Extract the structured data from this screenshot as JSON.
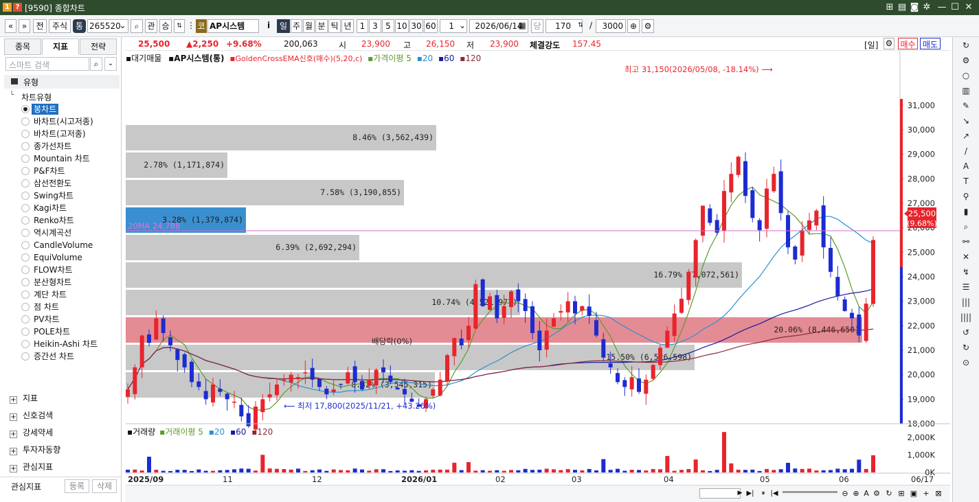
{
  "window": {
    "title": "[9590] 종합차트"
  },
  "toolbar": {
    "prev_label": "«",
    "next_label": "»",
    "all_label": "전",
    "stock_label": "주식",
    "tong_label": "통",
    "code": "265520",
    "gwan_label": "관",
    "seung_label": "승",
    "go_label": "코",
    "system_name": "AP시스템",
    "i_label": "i",
    "periods": [
      "일",
      "주",
      "월",
      "분",
      "틱",
      "년"
    ],
    "numbers": [
      "1",
      "3",
      "5",
      "10",
      "30",
      "60"
    ],
    "sel_value": "1",
    "date": "2026/06/14",
    "dang_label": "당",
    "count": "170",
    "total": "3000",
    "slash": "/"
  },
  "left_panel": {
    "tabs": [
      "종목",
      "지표",
      "전략"
    ],
    "search_placeholder": "스마트 검색",
    "root_label": "유형",
    "group_label": "차트유형",
    "chart_types": [
      "봉차트",
      "바차트(시고저종)",
      "바차트(고저종)",
      "종가선차트",
      "Mountain 차트",
      "P&F차트",
      "삼선전환도",
      "Swing차트",
      "Kagi차트",
      "Renko차트",
      "역시계곡선",
      "CandleVolume",
      "EquiVolume",
      "FLOW차트",
      "분산형차트",
      "계단 차트",
      "점 차트",
      "PV차트",
      "POLE차트",
      "Heikin-Ashi 차트",
      "증간선 차트"
    ],
    "sections": [
      "지표",
      "신호검색",
      "강세약세",
      "투자자동향",
      "관심지표"
    ],
    "footer_label": "관심지표",
    "register_label": "등록",
    "delete_label": "삭제"
  },
  "quote": {
    "price": "25,500",
    "change": "▲2,250",
    "change_pct": "+9.68%",
    "volume": "200,063",
    "open_label": "시",
    "open": "23,900",
    "high_label": "고",
    "high": "26,150",
    "low_label": "저",
    "low": "23,900",
    "strength_label": "체결강도",
    "strength": "157.45",
    "period_tag": "[일]",
    "buy_label": "매수",
    "sell_label": "매도"
  },
  "legend": {
    "items": [
      "대기매물",
      "AP시스템(통)",
      "GoldenCrossEMA신호(매수)(5,20,c)",
      "가격이평 5",
      "20",
      "60",
      "120"
    ]
  },
  "volume_legend": {
    "items": [
      "거래량",
      "거래이평 5",
      "20",
      "60",
      "120"
    ]
  },
  "colors": {
    "up": "#e8242c",
    "down": "#1c2cd0",
    "ma5": "#5a9a2a",
    "ma20": "#2a8fd0",
    "ma60": "#1a1a9a",
    "ma120": "#8a2a3a",
    "profile_gray": "#c8c8c8",
    "profile_peak": "#e48c94",
    "titlebar": "#2e4b2e"
  },
  "price_profile": [
    {
      "label": "8.42% (3,545,315)"
    },
    {
      "label": "15.50% (6,526,598)"
    },
    {
      "label": "20.06% (8,446,650)"
    },
    {
      "label": "10.74% (4,521,977)"
    },
    {
      "label": "16.79% (7,072,561)"
    },
    {
      "label": "6.39% (2,692,294)"
    },
    {
      "label": "3.28% (1,379,874)"
    },
    {
      "label": "7.58% (3,190,855)"
    },
    {
      "label": "2.78% (1,171,874)"
    },
    {
      "label": "8.46% (3,562,439)"
    }
  ],
  "annotations": {
    "high_note": "최고 31,150(2026/05/08, -18.14%)",
    "low_note": "최저 17,800(2025/11/21, +43.26%)",
    "dividend_note": "배당락(0%)",
    "ma20_label": "20MA 24,788"
  },
  "chart_data": {
    "type": "candlestick",
    "y_axis_ticks": [
      "31,000",
      "30,000",
      "29,000",
      "28,000",
      "27,000",
      "26,000",
      "25,000",
      "24,000",
      "23,000",
      "22,000",
      "21,000",
      "20,000",
      "19,000",
      "18,000"
    ],
    "ylim": [
      17500,
      31600
    ],
    "x_axis_labels": [
      "2025/09",
      "11",
      "12",
      "2026/01",
      "02",
      "03",
      "04",
      "05",
      "06",
      "06/17"
    ],
    "last_price_tag": "25,500",
    "last_pct_tag": "(9.68%)",
    "volume_ticks": [
      "2,000K",
      "1,000K",
      "0K"
    ]
  }
}
